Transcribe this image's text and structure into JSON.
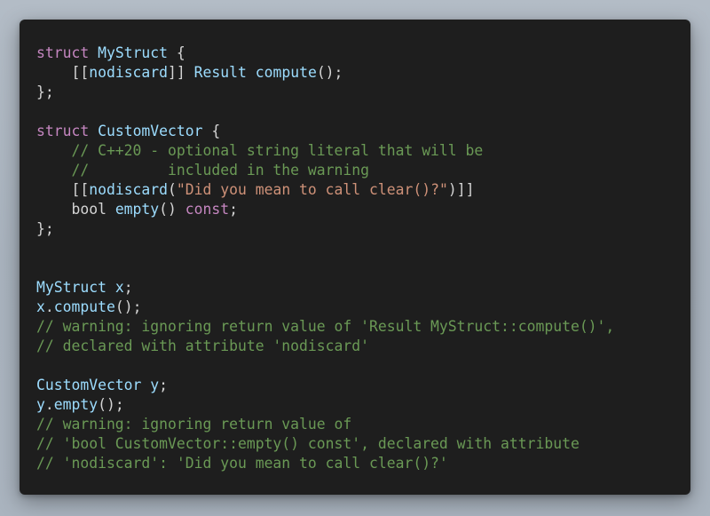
{
  "code": {
    "lines": [
      [
        {
          "t": "struct",
          "c": "kw"
        },
        {
          "t": " ",
          "c": "pl"
        },
        {
          "t": "MyStruct",
          "c": "ty"
        },
        {
          "t": " {",
          "c": "pl"
        }
      ],
      [
        {
          "t": "    [[",
          "c": "pl"
        },
        {
          "t": "nodiscard",
          "c": "at"
        },
        {
          "t": "]] ",
          "c": "pl"
        },
        {
          "t": "Result",
          "c": "ty"
        },
        {
          "t": " ",
          "c": "pl"
        },
        {
          "t": "compute",
          "c": "fn"
        },
        {
          "t": "();",
          "c": "pl"
        }
      ],
      [
        {
          "t": "};",
          "c": "pl"
        }
      ],
      [],
      [
        {
          "t": "struct",
          "c": "kw"
        },
        {
          "t": " ",
          "c": "pl"
        },
        {
          "t": "CustomVector",
          "c": "ty"
        },
        {
          "t": " {",
          "c": "pl"
        }
      ],
      [
        {
          "t": "    // C++20 - optional string literal that will be",
          "c": "cm"
        }
      ],
      [
        {
          "t": "    //         included in the warning",
          "c": "cm"
        }
      ],
      [
        {
          "t": "    [[",
          "c": "pl"
        },
        {
          "t": "nodiscard",
          "c": "at"
        },
        {
          "t": "(",
          "c": "pl"
        },
        {
          "t": "\"Did you mean to call clear()?\"",
          "c": "str"
        },
        {
          "t": ")]]",
          "c": "pl"
        }
      ],
      [
        {
          "t": "    bool ",
          "c": "pl"
        },
        {
          "t": "empty",
          "c": "fn"
        },
        {
          "t": "() ",
          "c": "pl"
        },
        {
          "t": "const",
          "c": "kw"
        },
        {
          "t": ";",
          "c": "pl"
        }
      ],
      [
        {
          "t": "};",
          "c": "pl"
        }
      ],
      [],
      [],
      [
        {
          "t": "MyStruct",
          "c": "ty"
        },
        {
          "t": " ",
          "c": "pl"
        },
        {
          "t": "x",
          "c": "ty"
        },
        {
          "t": ";",
          "c": "pl"
        }
      ],
      [
        {
          "t": "x",
          "c": "ty"
        },
        {
          "t": ".",
          "c": "pl"
        },
        {
          "t": "compute",
          "c": "fn"
        },
        {
          "t": "();",
          "c": "pl"
        }
      ],
      [
        {
          "t": "// warning: ignoring return value of 'Result MyStruct::compute()',",
          "c": "cm"
        }
      ],
      [
        {
          "t": "// declared with attribute 'nodiscard'",
          "c": "cm"
        }
      ],
      [],
      [
        {
          "t": "CustomVector",
          "c": "ty"
        },
        {
          "t": " ",
          "c": "pl"
        },
        {
          "t": "y",
          "c": "ty"
        },
        {
          "t": ";",
          "c": "pl"
        }
      ],
      [
        {
          "t": "y",
          "c": "ty"
        },
        {
          "t": ".",
          "c": "pl"
        },
        {
          "t": "empty",
          "c": "fn"
        },
        {
          "t": "();",
          "c": "pl"
        }
      ],
      [
        {
          "t": "// warning: ignoring return value of",
          "c": "cm"
        }
      ],
      [
        {
          "t": "// 'bool CustomVector::empty() const', declared with attribute",
          "c": "cm"
        }
      ],
      [
        {
          "t": "// 'nodiscard': 'Did you mean to call clear()?'",
          "c": "cm"
        }
      ]
    ]
  },
  "colors": {
    "keyword": "#c586c0",
    "type": "#9cdcfe",
    "comment": "#6a9955",
    "string": "#ce9178",
    "plain": "#d4d4d4",
    "background": "#1e1e1e"
  }
}
